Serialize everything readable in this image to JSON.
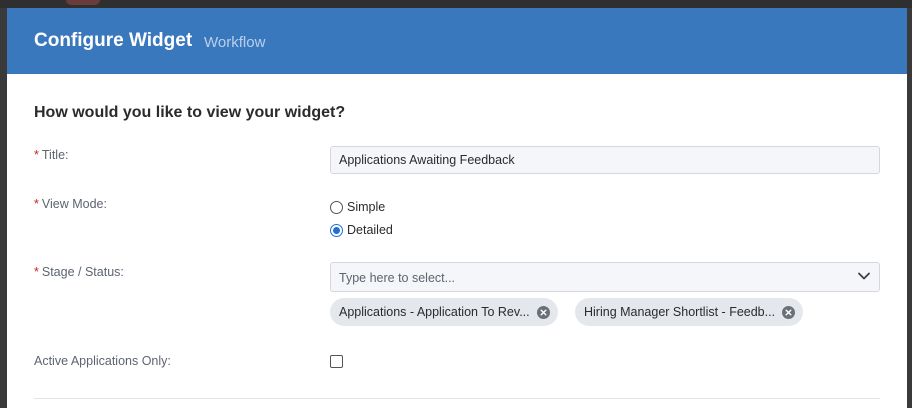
{
  "header": {
    "title": "Configure Widget",
    "subtitle": "Workflow"
  },
  "form": {
    "question": "How would you like to view your widget?",
    "required_marker": "*",
    "title_field": {
      "label": "Title:",
      "value": "Applications Awaiting Feedback"
    },
    "view_mode": {
      "label": "View Mode:",
      "options": [
        {
          "label": "Simple",
          "selected": false
        },
        {
          "label": "Detailed",
          "selected": true
        }
      ]
    },
    "stage_status": {
      "label": "Stage / Status:",
      "placeholder": "Type here to select...",
      "selected_chips": [
        "Applications - Application To Rev...",
        "Hiring Manager Shortlist - Feedb..."
      ]
    },
    "active_only": {
      "label": "Active Applications Only:",
      "checked": false
    }
  },
  "icons": {
    "dropdown": "chevron-down-icon",
    "remove_chip": "close-circle-icon"
  },
  "colors": {
    "header_bg": "#3a78be",
    "accent": "#1f6fd6",
    "required": "#cc2222"
  }
}
